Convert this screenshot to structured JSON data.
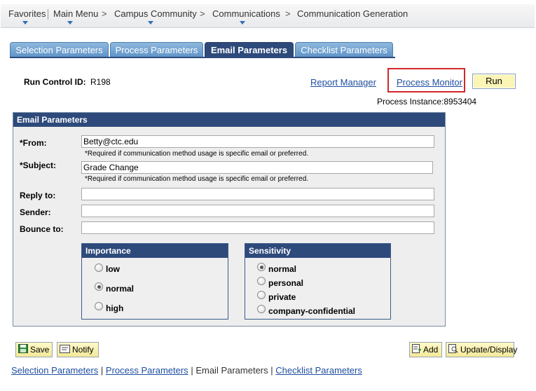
{
  "nav": {
    "favorites": "Favorites",
    "main_menu": "Main Menu",
    "campus_community": "Campus Community",
    "communications": "Communications",
    "communication_generation": "Communication Generation",
    "separator": ">"
  },
  "tabs": [
    {
      "label": "Selection Parameters"
    },
    {
      "label": "Process Parameters"
    },
    {
      "label": "Email Parameters",
      "active": true
    },
    {
      "label": "Checklist Parameters"
    }
  ],
  "run_control": {
    "label": "Run Control ID:",
    "value": "R198"
  },
  "links": {
    "report_manager": "Report Manager",
    "process_monitor": "Process Monitor"
  },
  "run_button": "Run",
  "process_instance": "Process Instance:8953404",
  "email_params": {
    "header": "Email Parameters",
    "from": {
      "label": "*From:",
      "value": "Betty@ctc.edu",
      "note": "*Required if communication method usage is specific email or preferred."
    },
    "subject": {
      "label": "*Subject:",
      "value": "Grade Change",
      "note": "*Required if communication method usage is specific email or preferred."
    },
    "reply_to": {
      "label": "Reply to:",
      "value": ""
    },
    "sender": {
      "label": "Sender:",
      "value": ""
    },
    "bounce_to": {
      "label": "Bounce to:",
      "value": ""
    }
  },
  "importance": {
    "header": "Importance",
    "options": [
      {
        "label": "low",
        "checked": false
      },
      {
        "label": "normal",
        "checked": true
      },
      {
        "label": "high",
        "checked": false
      }
    ]
  },
  "sensitivity": {
    "header": "Sensitivity",
    "options": [
      {
        "label": "normal",
        "checked": true
      },
      {
        "label": "personal",
        "checked": false
      },
      {
        "label": "private",
        "checked": false
      },
      {
        "label": "company-confidential",
        "checked": false
      }
    ]
  },
  "buttons": {
    "save": "Save",
    "notify": "Notify",
    "add": "Add",
    "update_display": "Update/Display"
  },
  "bottom_links": {
    "selection": "Selection Parameters",
    "process": "Process Parameters",
    "email": "Email Parameters",
    "checklist": "Checklist Parameters",
    "separator": "|"
  },
  "colors": {
    "header_blue": "#2e4a7b",
    "tab_blue": "#6a9bcc",
    "highlight_red": "#d3262c",
    "button_yellow": "#fbf5b6"
  }
}
